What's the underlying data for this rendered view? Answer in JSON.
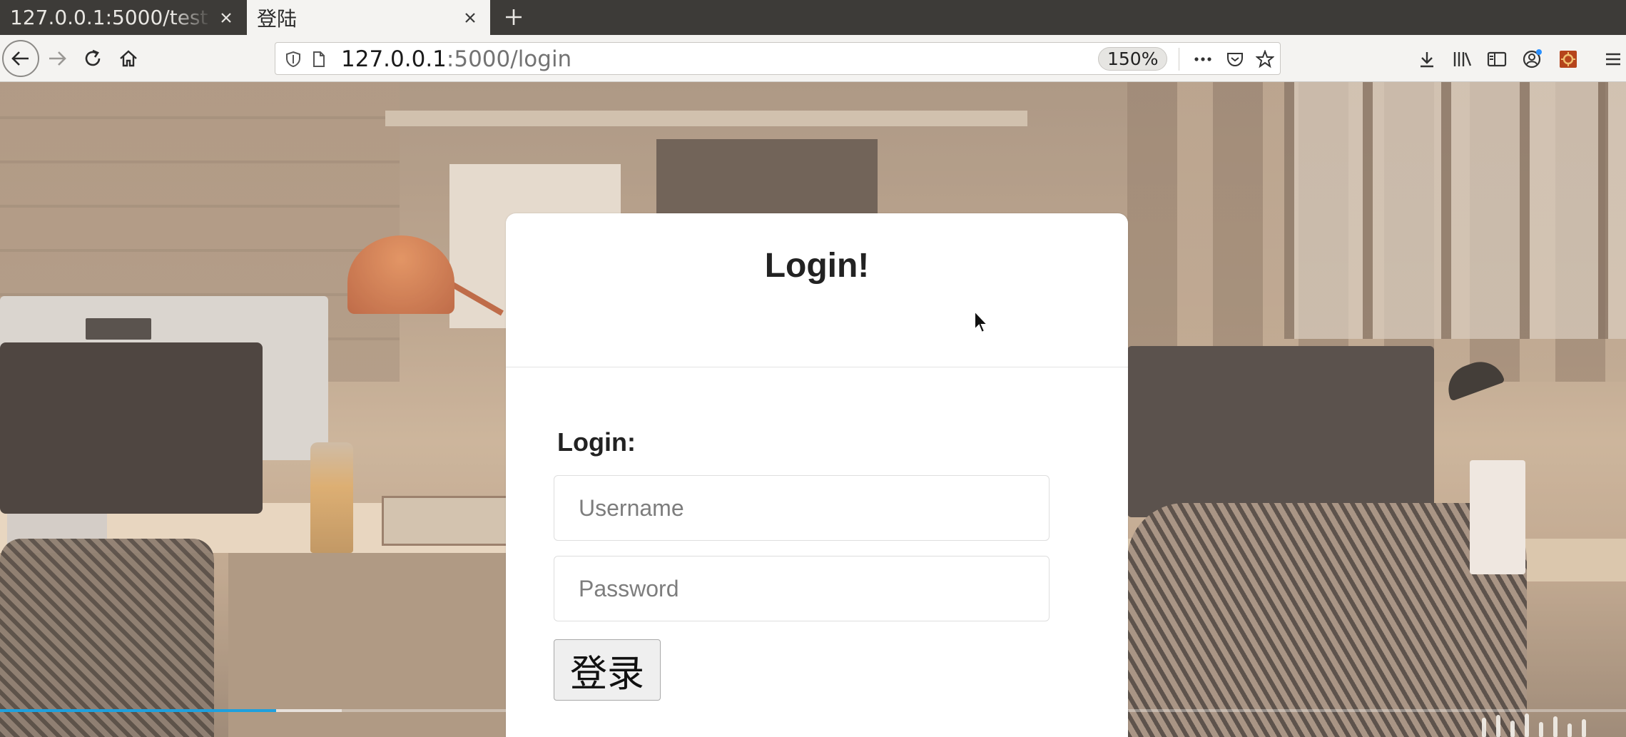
{
  "browser": {
    "tabs": [
      {
        "title": "127.0.0.1:5000/test",
        "active": false
      },
      {
        "title": "登陆",
        "active": true
      }
    ],
    "url": {
      "host": "127.0.0.1",
      "rest": ":5000/login"
    },
    "zoom": "150%"
  },
  "page": {
    "card_title": "Login!",
    "form_label": "Login:",
    "username_placeholder": "Username",
    "password_placeholder": "Password",
    "submit_label": "登录"
  },
  "video": {
    "progress": 0.17,
    "buffered": 0.21
  },
  "colors": {
    "progress_fill": "#1ea0dd",
    "tabstrip": "#3d3b38",
    "toolbar": "#f4f3f1"
  }
}
